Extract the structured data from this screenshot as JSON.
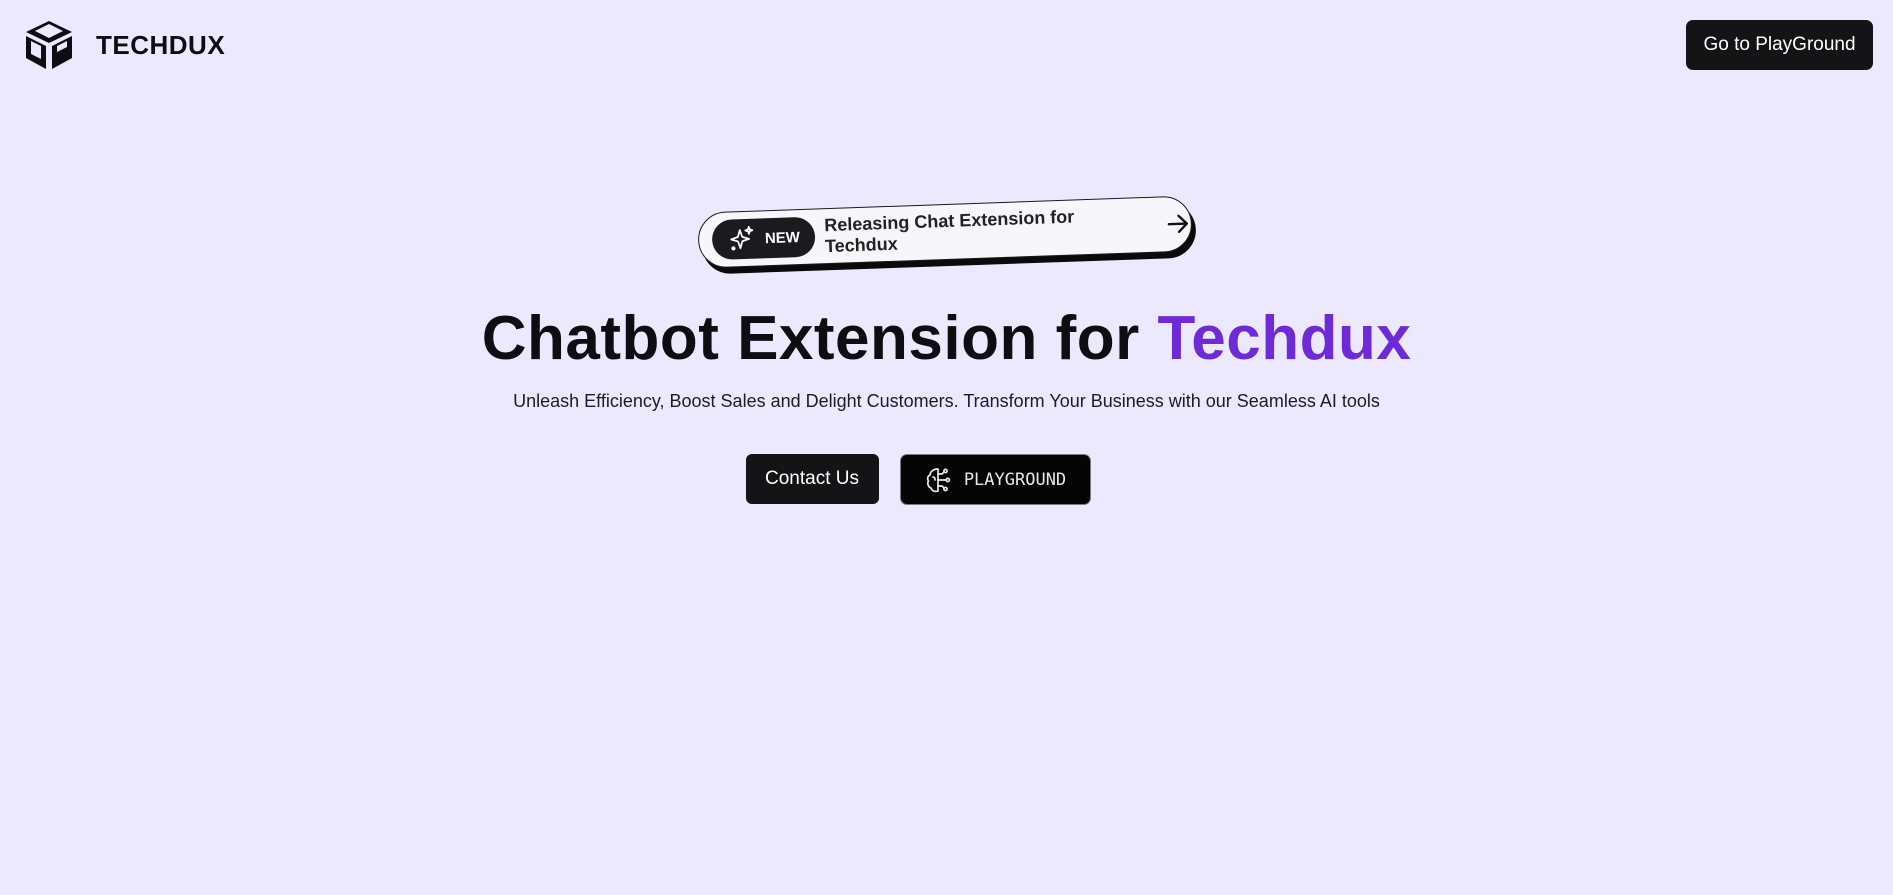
{
  "header": {
    "brand": "TECHDUX",
    "logo_icon": "cube-logo-icon",
    "cta_label": "Go to PlayGround"
  },
  "announcement": {
    "badge_icon": "sparkles-icon",
    "badge_label": "NEW",
    "text": "Releasing Chat Extension for Techdux",
    "arrow_icon": "arrow-right-icon"
  },
  "hero": {
    "title_main": "Chatbot Extension for ",
    "title_accent": "Techdux",
    "subtitle": "Unleash Efficiency, Boost Sales and Delight Customers. Transform Your Business with our Seamless AI tools",
    "primary_button": "Contact Us",
    "secondary_button": "PLAYGROUND",
    "secondary_icon": "brain-circuit-icon"
  },
  "colors": {
    "background": "#ece9ff",
    "accent": "#6d2ad6",
    "dark": "#141416"
  }
}
